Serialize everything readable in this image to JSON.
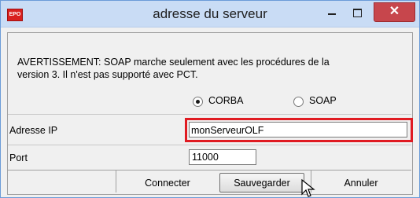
{
  "window": {
    "title": "adresse du serveur",
    "app_icon_text": "EPO",
    "accent_color": "#e01b22"
  },
  "warning": {
    "line1": "AVERTISSEMENT: SOAP marche seulement avec les procédures de la",
    "line2": "version 3. Il n'est pas supporté avec PCT."
  },
  "protocol": {
    "options": [
      {
        "label": "CORBA",
        "checked": true
      },
      {
        "label": "SOAP",
        "checked": false
      }
    ]
  },
  "form": {
    "ip_label": "Adresse IP",
    "ip_value": "monServeurOLF",
    "port_label": "Port",
    "port_value": "11000"
  },
  "buttons": {
    "connect": "Connecter",
    "save": "Sauvegarder",
    "cancel": "Annuler"
  }
}
